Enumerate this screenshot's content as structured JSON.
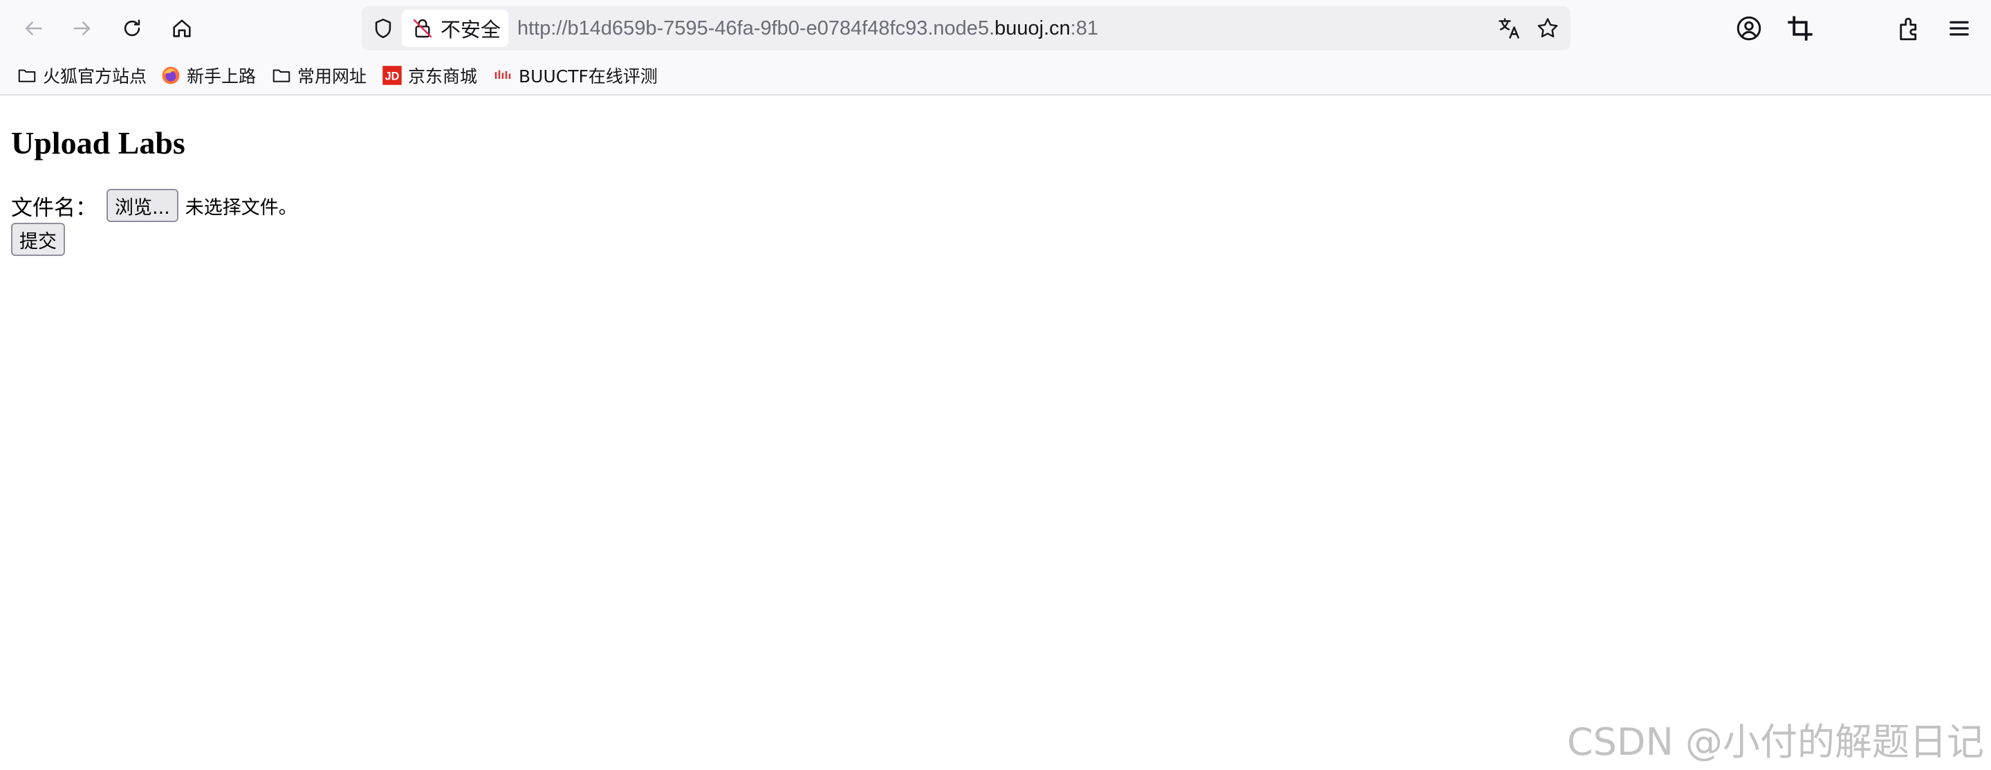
{
  "browser": {
    "insecure_label": "不安全",
    "url_prefix": "http://b14d659b-7595-46fa-9fb0-e0784f48fc93.node5.",
    "url_domain": "buuoj.cn",
    "url_suffix": ":81",
    "nav_icons": [
      "back-arrow-icon",
      "forward-arrow-icon",
      "reload-icon",
      "home-icon"
    ],
    "url_icons": [
      "shield-icon",
      "insecure-lock-icon",
      "translate-icon",
      "bookmark-star-icon"
    ],
    "toolbar_icons": [
      "account-icon",
      "screenshot-crop-icon",
      "extensions-icon",
      "menu-icon"
    ]
  },
  "bookmarks": [
    {
      "label": "火狐官方站点",
      "icon": "folder-icon"
    },
    {
      "label": "新手上路",
      "icon": "firefox-logo-icon"
    },
    {
      "label": "常用网址",
      "icon": "folder-icon"
    },
    {
      "label": "京东商城",
      "icon": "jd-logo-icon"
    },
    {
      "label": "BUUCTF在线评测",
      "icon": "buuctf-logo-icon"
    }
  ],
  "page": {
    "title": "Upload Labs",
    "file_label": "文件名：",
    "browse_label": "浏览...",
    "no_file_text": "未选择文件。",
    "submit_label": "提交"
  },
  "watermark": "CSDN @小付的解题日记",
  "colors": {
    "chrome_bg": "#f9f9fb",
    "url_bar_bg": "#efeff3",
    "button_bg": "#e9e9ed",
    "button_border": "#8f8f9d",
    "jd_red": "#e1251b"
  }
}
